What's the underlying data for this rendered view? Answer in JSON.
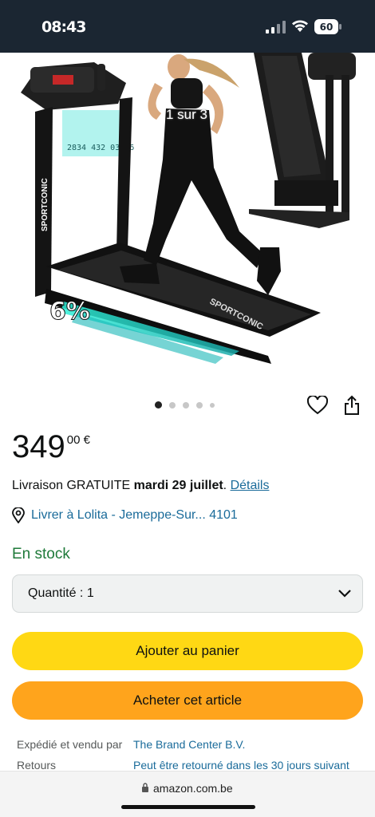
{
  "status_bar": {
    "time": "08:43",
    "battery": "60"
  },
  "gallery": {
    "counter": "1 sur 3",
    "dots": 5,
    "active_index": 0,
    "brand_print": "SPORTCONIC",
    "incline_badge": "6%",
    "console_readout": "2834 432 03 86"
  },
  "product": {
    "price_whole": "349",
    "price_fraction": "00 €",
    "delivery_prefix": "Livraison GRATUITE ",
    "delivery_date": "mardi 29 juillet",
    "delivery_suffix": ". ",
    "details_link": "Détails",
    "deliver_to": "Livrer à Lolita - Jemeppe-Sur... 4101",
    "stock": "En stock",
    "quantity_label": "Quantité : 1",
    "add_to_cart": "Ajouter au panier",
    "buy_now": "Acheter cet article"
  },
  "seller": {
    "shipped_sold_label": "Expédié et vendu par",
    "shipped_sold_value": "The Brand Center B.V.",
    "returns_label": "Retours",
    "returns_value": "Peut être retourné dans les 30 jours suivant"
  },
  "browser": {
    "url": "amazon.com.be"
  },
  "colors": {
    "status_bg": "#1b2632",
    "cart_button": "#ffd814",
    "buy_button": "#ffa41c",
    "link": "#1a6b9a",
    "stock": "#1f7a3a"
  },
  "icons": [
    "signal-icon",
    "wifi-icon",
    "battery-icon",
    "heart-icon",
    "share-icon",
    "location-pin-icon",
    "chevron-down-icon",
    "lock-icon"
  ]
}
